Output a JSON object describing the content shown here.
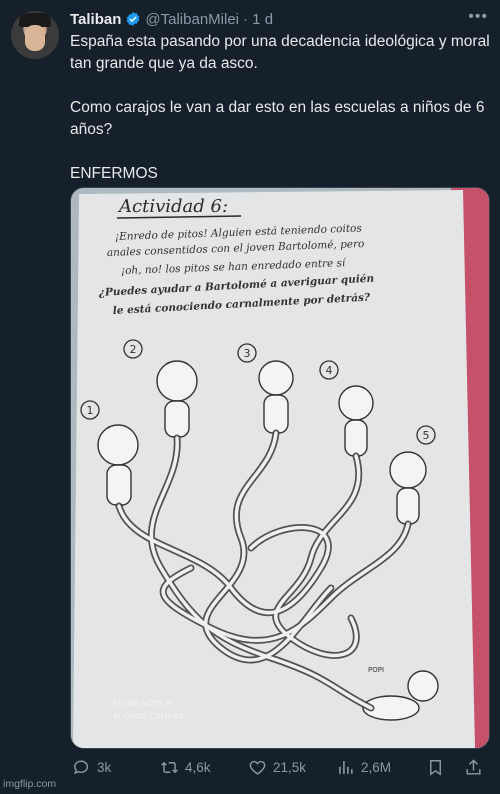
{
  "tweet": {
    "author_name": "Taliban",
    "author_handle": "@TalibanMilei",
    "time": "· 1 d",
    "paragraphs": [
      "España esta pasando por una decadencia ideológica y moral tan grande que ya da asco.",
      "Como carajos le van a dar esto en las escuelas a niños de 6 años?",
      "ENFERMOS"
    ]
  },
  "media": {
    "title": "Actividad 6:",
    "lines": [
      "¡Enredo de pitos! Alguien está teniendo coitos",
      "anales consentidos con el joven Bartolomé, pero",
      "¡oh, no! los pitos se han enredado entre sí",
      "¿Puedes ayudar a Bartolomé a averiguar quién",
      "le está conociendo carnalmente por detrás?"
    ],
    "numbers": [
      "1",
      "2",
      "3",
      "4",
      "5"
    ],
    "popi_label": "POPI",
    "camera_line1": "REDMI NOTE 8",
    "camera_line2": "AI QUAD CAMERA"
  },
  "actions": {
    "replies": "3k",
    "reposts": "4,6k",
    "likes": "21,5k",
    "views": "2,6M"
  },
  "watermark": "imgflip.com",
  "colors": {
    "background": "#15202b",
    "text": "#e7e9ea",
    "muted": "#8b98a5",
    "verified": "#1d9bf0"
  }
}
